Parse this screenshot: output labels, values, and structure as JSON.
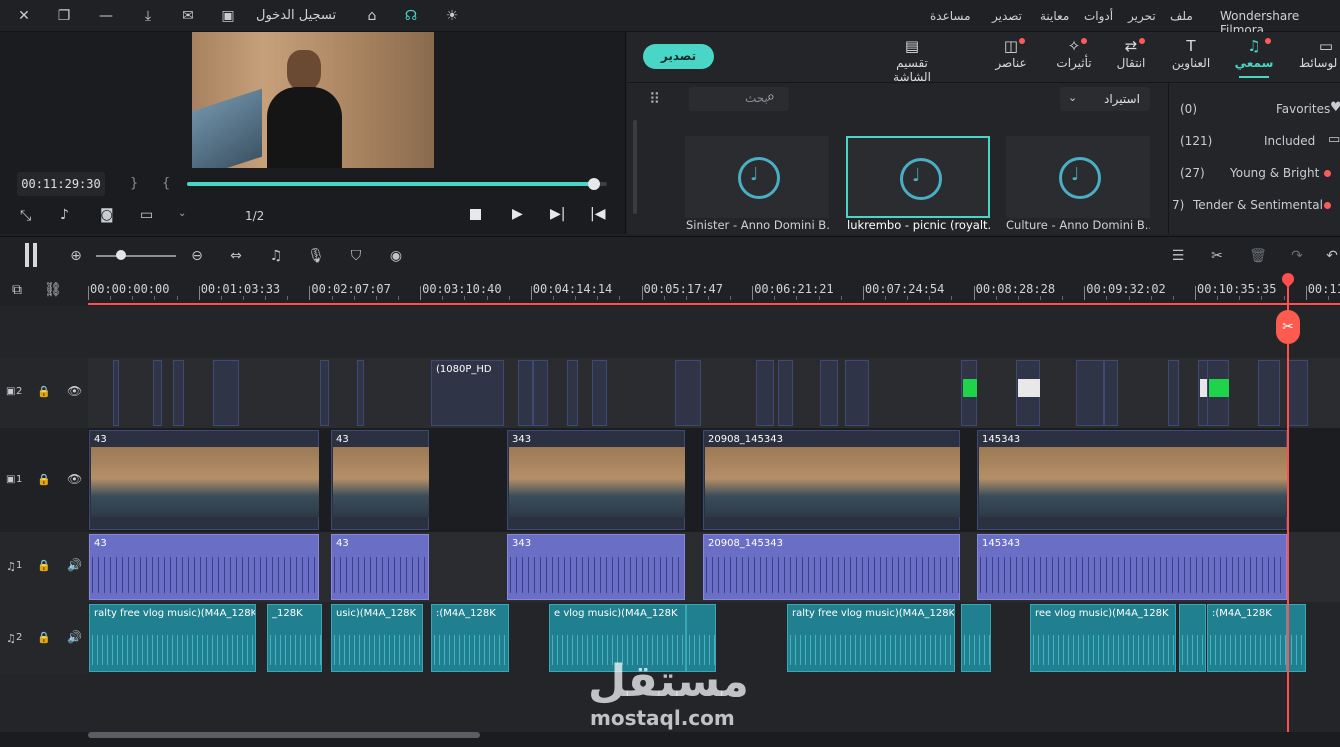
{
  "app": {
    "title": "Wondershare Filmora"
  },
  "menu": {
    "items": [
      "ملف",
      "تحرير",
      "أدوات",
      "معاينة",
      "تصدير",
      "مساعدة"
    ],
    "login": "تسجيل الدخول"
  },
  "preview": {
    "timecode": "00:11:29:30",
    "page": "1/2",
    "progress": 0.97
  },
  "media_panel": {
    "export_label": "تصدير",
    "tabs": [
      {
        "label": "لوسائط",
        "icon": "folder-icon"
      },
      {
        "label": "سمعي",
        "icon": "music-icon",
        "active": true
      },
      {
        "label": "العناوين",
        "icon": "text-icon"
      },
      {
        "label": "انتقال",
        "icon": "transition-icon"
      },
      {
        "label": "تأثيرات",
        "icon": "effects-icon"
      },
      {
        "label": "عناصر",
        "icon": "elements-icon"
      },
      {
        "label": "تقسيم الشاشة",
        "icon": "split-screen-icon"
      }
    ],
    "import_label": "استيراد",
    "search_placeholder": "بحث",
    "categories": [
      {
        "name": "Favorites",
        "count": "(0)",
        "icon": "heart-icon"
      },
      {
        "name": "Included",
        "count": "(121)",
        "icon": "folder-icon"
      },
      {
        "name": "Young & Bright",
        "count": "(27)",
        "icon": "dot"
      },
      {
        "name": "Tender & Sentimental",
        "count": "7)",
        "icon": "dot"
      }
    ],
    "cards": [
      {
        "label": "Sinister - Anno Domini B..."
      },
      {
        "label": "lukrembo - picnic (royalt...",
        "selected": true
      },
      {
        "label": "Culture - Anno Domini B..."
      }
    ]
  },
  "timeline": {
    "ruler": [
      "00:00:00:00",
      "00:01:03:33",
      "00:02:07:07",
      "00:03:10:40",
      "00:04:14:14",
      "00:05:17:47",
      "00:06:21:21",
      "00:07:24:54",
      "00:08:28:28",
      "00:09:32:02",
      "00:10:35:35",
      "00:11:3"
    ],
    "tracks": {
      "v2": {
        "label": "2",
        "clip_label": "(1080P_HD"
      },
      "v1": {
        "label": "1",
        "clips": [
          "43",
          "908_145343",
          "43",
          "43",
          "343",
          "08_145343",
          "20908_145343",
          "343",
          "145343",
          "145343"
        ]
      },
      "a1": {
        "label": "1",
        "clips": [
          "43",
          "908_145343",
          "43",
          "343",
          "08_145343",
          "20908_145343",
          "145343",
          "145343"
        ]
      },
      "a2": {
        "label": "2",
        "clips": [
          "ralty free vlog music)(M4A_128K",
          "_128K",
          "usic)(M4A_128K",
          ":(M4A_128K",
          "e vlog music)(M4A_128K",
          "ralty free vlog music)(M4A_128K",
          "ree vlog music)(M4A_128K",
          ":(M4A_128K"
        ]
      }
    }
  },
  "watermark": {
    "arabic": "مستقل",
    "latin": "mostaql.com"
  },
  "colors": {
    "accent": "#4ad6c6",
    "playhead": "#ff4f4f",
    "audio_clip": "#6a6ec4",
    "music_clip": "#218090",
    "video_border": "#3f4a74"
  }
}
